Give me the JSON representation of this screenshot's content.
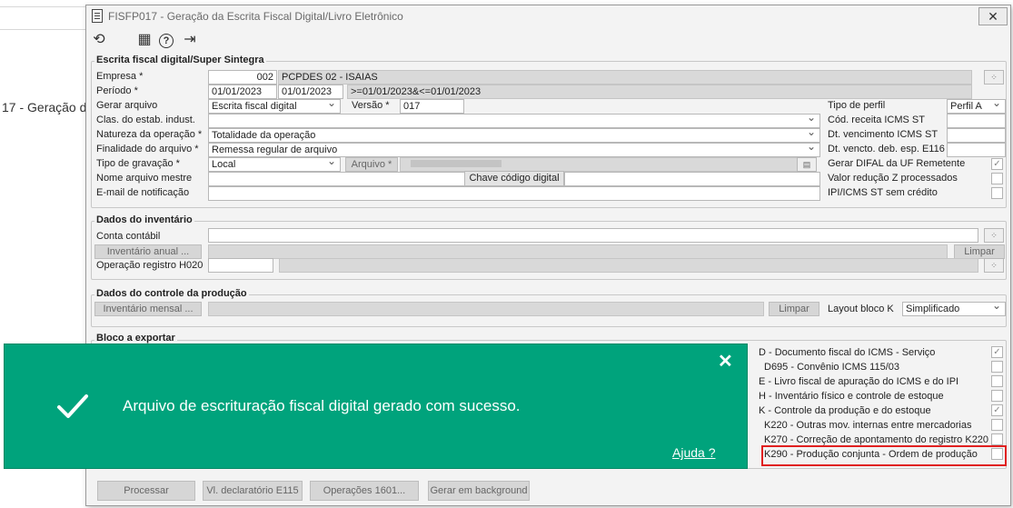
{
  "background": {
    "text": "17 - Geração d"
  },
  "window": {
    "title": "FISFP017 - Geração da Escrita Fiscal Digital/Livro Eletrônico",
    "close_label": "✕"
  },
  "toolbar": {
    "icons": [
      "undo-icon",
      "calendar-icon",
      "help-icon",
      "exit-icon"
    ],
    "undo_glyph": "⟲",
    "calendar_glyph": "▦",
    "help_glyph": "?",
    "exit_glyph": "⇥"
  },
  "sped": {
    "legend": "Escrita fiscal digital/Super Sintegra",
    "empresa_label": "Empresa *",
    "empresa_code": "002",
    "empresa_name": "PCPDES 02 - ISAIAS",
    "periodo_label": "Período *",
    "periodo_de": "01/01/2023",
    "periodo_ate": "01/01/2023",
    "periodo_expr": ">=01/01/2023&<=01/01/2023",
    "gerar_label": "Gerar arquivo",
    "gerar_value": "Escrita fiscal digital",
    "versao_label": "Versão *",
    "versao_value": "017",
    "tipo_perfil_label": "Tipo de perfil",
    "tipo_perfil_value": "Perfil A",
    "clas_label": "Clas. do estab. indust.",
    "clas_value": "",
    "cod_receita_label": "Cód. receita ICMS ST",
    "natureza_label": "Natureza da operação *",
    "natureza_value": "Totalidade da operação",
    "dt_venc_label": "Dt. vencimento ICMS ST",
    "finalidade_label": "Finalidade do arquivo *",
    "finalidade_value": "Remessa regular de arquivo",
    "dt_venc_deb_label": "Dt. vencto. deb. esp. E116",
    "tipo_grav_label": "Tipo de gravação *",
    "tipo_grav_value": "Local",
    "arquivo_label": "Arquivo *",
    "gerar_difal_label": "Gerar DIFAL da UF Remetente",
    "nome_mestre_label": "Nome arquivo mestre",
    "chave_btn": "Chave código digital",
    "valor_reducao_label": "Valor redução Z processados",
    "email_label": "E-mail de notificação",
    "ipi_label": "IPI/ICMS ST sem crédito",
    "gerar_difal_checked": true,
    "valor_reducao_checked": false,
    "ipi_checked": false
  },
  "inventario": {
    "legend": "Dados do inventário",
    "conta_label": "Conta contábil",
    "inv_anual_btn": "Inventário anual ...",
    "limpar_btn": "Limpar",
    "operacao_label": "Operação registro H020"
  },
  "producao": {
    "legend": "Dados do controle da produção",
    "inv_mensal_btn": "Inventário mensal ...",
    "limpar_btn": "Limpar",
    "layout_label": "Layout bloco K",
    "layout_value": "Simplificado"
  },
  "blocos": {
    "legend": "Bloco a exportar",
    "items": [
      {
        "label": "D - Documento fiscal do ICMS - Serviço",
        "checked": true
      },
      {
        "label": "D695 - Convênio ICMS 115/03",
        "checked": false
      },
      {
        "label": "E - Livro fiscal de apuração do ICMS e do IPI",
        "checked": false
      },
      {
        "label": "H - Inventário físico e controle de estoque",
        "checked": false
      },
      {
        "label": "K - Controle da produção e do estoque",
        "checked": true
      },
      {
        "label": "K220 - Outras mov. internas entre mercadorias",
        "checked": false
      },
      {
        "label": "K270 - Correção de apontamento do registro K220",
        "checked": false
      },
      {
        "label": "K290 - Produção conjunta - Ordem de produção",
        "checked": false
      }
    ]
  },
  "actions": {
    "processar": "Processar",
    "vl_declaratorio": "Vl. declaratório E115",
    "operacoes": "Operações 1601...",
    "gerar_background": "Gerar em background"
  },
  "toast": {
    "message": "Arquivo de escrituração fiscal digital gerado com sucesso.",
    "help_link": "Ajuda ?",
    "close_label": "✕",
    "color": "#00a37c"
  }
}
